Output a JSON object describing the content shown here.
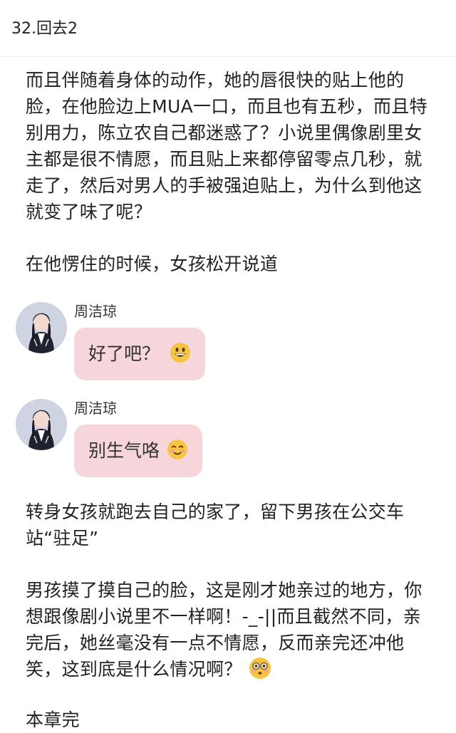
{
  "header": {
    "title": "32.回去2"
  },
  "story": {
    "p1": "而且伴随着身体的动作，她的唇很快的贴上他的脸，在他脸边上MUA一口，而且也有五秒，而且特别用力，陈立农自己都迷惑了？小说里偶像剧里女主都是很不情愿，而且贴上来都停留零点几秒，就走了，然后对男人的手被强迫贴上，为什么到他这就变了味了呢？",
    "p2": "在他愣住的时候，女孩松开说道",
    "p3": "转身女孩就跑去自己的家了，留下男孩在公交车站“驻足”",
    "p4": "男孩摸了摸自己的脸，这是刚才她亲过的地方，你想跟像剧小说里不一样啊！-_-||而且截然不同，亲完后，她丝毫没有一点不情愿，反而亲完还冲他笑，这到底是什么情况啊？",
    "p5": "本章完"
  },
  "messages": [
    {
      "sender": "周洁琼",
      "text": "好了吧？",
      "emoji": "grinning-face"
    },
    {
      "sender": "周洁琼",
      "text": "别生气咯",
      "emoji": "smiling-face"
    }
  ],
  "colors": {
    "bubble": "#f6d6da",
    "emoji": "#f5c542"
  }
}
